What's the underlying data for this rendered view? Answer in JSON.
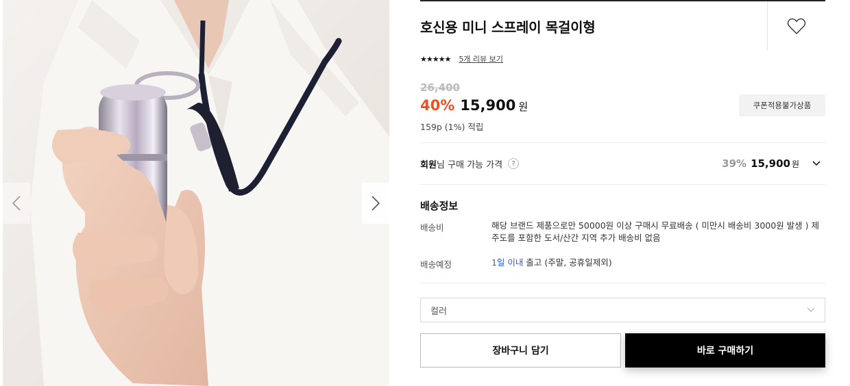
{
  "gallery": {
    "image_alt": "",
    "prev_icon": "chevron-left-icon",
    "next_icon": "chevron-right-icon"
  },
  "product": {
    "title": "호신용 미니 스프레이 목걸이형",
    "rating_stars": "★★★★★",
    "review_link": "5개 리뷰 보기",
    "wish_icon": "heart-outline-icon"
  },
  "price": {
    "original": "26,400",
    "discount": "40%",
    "sale": "15,900",
    "currency": "원",
    "points": "159p (1%) 적립",
    "coupon_badge": "쿠폰적용불가상품"
  },
  "member": {
    "label_bold": "회원",
    "label_rest": "님 구매 가능 가격",
    "help_icon_text": "?",
    "discount": "39%",
    "price": "15,900",
    "currency": "원"
  },
  "shipping": {
    "heading": "배송정보",
    "fee_label": "배송비",
    "fee_text": "해당 브랜드 제품으로만 50000원 이상 구매시 무료배송 ( 미만시 배송비 3000원 발생 ) 제주도를 포함한 도서/산간 지역 추가 배송비 없음",
    "eta_label": "배송예정",
    "eta_highlight": "1일 이내",
    "eta_rest": " 출고 (주말, 공휴일제외)"
  },
  "option": {
    "placeholder": "컬러"
  },
  "actions": {
    "cart_label": "장바구니 담기",
    "buy_label": "바로 구매하기"
  },
  "colors": {
    "discount_red": "#f04e23",
    "link_blue": "#2f5bd8",
    "buy_bg": "#000000"
  }
}
